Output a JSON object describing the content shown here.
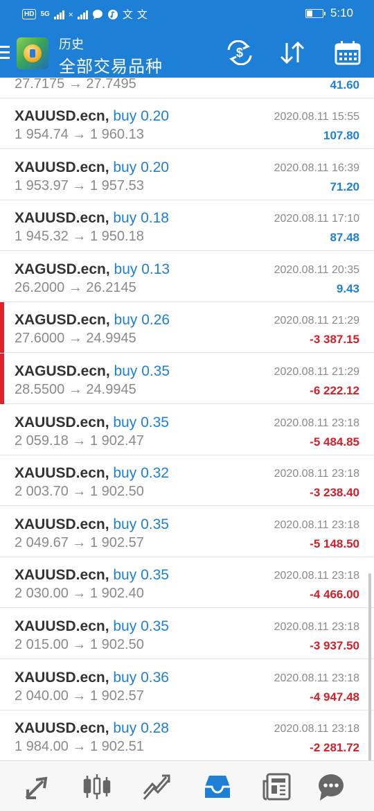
{
  "status_bar": {
    "hd": "HD",
    "net": "5G",
    "sim": "×",
    "glyph_a": "文",
    "glyph_b": "文",
    "time": "5:10",
    "icons": [
      "hd-icon",
      "signal-5g-icon",
      "signal-icon",
      "message-icon",
      "music-icon",
      "battery-icon"
    ]
  },
  "header": {
    "subtitle": "历史",
    "title": "全部交易品种",
    "actions": [
      "exchange-currency-icon",
      "sort-icon",
      "calendar-icon"
    ]
  },
  "partial_row": {
    "prices": "27.7175 → 27.7495",
    "pl": "41.60"
  },
  "trades": [
    {
      "symbol": "XAUUSD.ecn,",
      "direction": "buy 0.20",
      "prices": "1 954.74 → 1 960.13",
      "datetime": "2020.08.11 15:55",
      "pl": "107.80",
      "positive": true
    },
    {
      "symbol": "XAUUSD.ecn,",
      "direction": "buy 0.20",
      "prices": "1 953.97 → 1 957.53",
      "datetime": "2020.08.11 16:39",
      "pl": "71.20",
      "positive": true
    },
    {
      "symbol": "XAUUSD.ecn,",
      "direction": "buy 0.18",
      "prices": "1 945.32 → 1 950.18",
      "datetime": "2020.08.11 17:10",
      "pl": "87.48",
      "positive": true
    },
    {
      "symbol": "XAGUSD.ecn,",
      "direction": "buy 0.13",
      "prices": "26.2000 → 26.2145",
      "datetime": "2020.08.11 20:35",
      "pl": "9.43",
      "positive": true
    },
    {
      "symbol": "XAGUSD.ecn,",
      "direction": "buy 0.26",
      "prices": "27.6000 → 24.9945",
      "datetime": "2020.08.11 21:29",
      "pl": "-3 387.15",
      "positive": false
    },
    {
      "symbol": "XAGUSD.ecn,",
      "direction": "buy 0.35",
      "prices": "28.5500 → 24.9945",
      "datetime": "2020.08.11 21:29",
      "pl": "-6 222.12",
      "positive": false
    },
    {
      "symbol": "XAUUSD.ecn,",
      "direction": "buy 0.35",
      "prices": "2 059.18 → 1 902.47",
      "datetime": "2020.08.11 23:18",
      "pl": "-5 484.85",
      "positive": false
    },
    {
      "symbol": "XAUUSD.ecn,",
      "direction": "buy 0.32",
      "prices": "2 003.70 → 1 902.50",
      "datetime": "2020.08.11 23:18",
      "pl": "-3 238.40",
      "positive": false
    },
    {
      "symbol": "XAUUSD.ecn,",
      "direction": "buy 0.35",
      "prices": "2 049.67 → 1 902.57",
      "datetime": "2020.08.11 23:18",
      "pl": "-5 148.50",
      "positive": false
    },
    {
      "symbol": "XAUUSD.ecn,",
      "direction": "buy 0.35",
      "prices": "2 030.00 → 1 902.40",
      "datetime": "2020.08.11 23:18",
      "pl": "-4 466.00",
      "positive": false
    },
    {
      "symbol": "XAUUSD.ecn,",
      "direction": "buy 0.35",
      "prices": "2 015.00 → 1 902.50",
      "datetime": "2020.08.11 23:18",
      "pl": "-3 937.50",
      "positive": false
    },
    {
      "symbol": "XAUUSD.ecn,",
      "direction": "buy 0.36",
      "prices": "2 040.00 → 1 902.57",
      "datetime": "2020.08.11 23:18",
      "pl": "-4 947.48",
      "positive": false
    },
    {
      "symbol": "XAUUSD.ecn,",
      "direction": "buy 0.28",
      "prices": "1 984.00 → 1 902.51",
      "datetime": "2020.08.11 23:18",
      "pl": "-2 281.72",
      "positive": false
    }
  ],
  "bottom_nav": {
    "items": [
      "quotes-icon",
      "chart-icon",
      "trade-icon",
      "history-icon",
      "news-icon",
      "chat-icon"
    ],
    "active": "history-icon"
  },
  "colors": {
    "accent": "#1e7fd6",
    "profit": "#1e7fd6",
    "loss": "#d0202a",
    "loss_marker": "#e0222a",
    "text_primary": "#333333",
    "text_secondary": "#8a8a8a"
  }
}
